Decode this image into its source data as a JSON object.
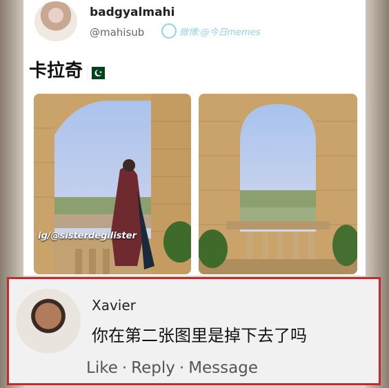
{
  "post": {
    "username": "badgyalmahi",
    "handle": "@mahisub",
    "watermark": "微博:@今日memes",
    "text": "卡拉奇",
    "flag_icon": "pakistan-flag-icon",
    "image_credit": "ig/@sisterdegilister"
  },
  "comment": {
    "name": "Xavier",
    "text": "你在第二张图里是掉下去了吗",
    "actions": [
      "Like",
      "·",
      "Reply",
      "·",
      "Message"
    ]
  },
  "colors": {
    "highlight_border": "#c8282a",
    "watermark": "#8fd3e6",
    "flag_green": "#01411c"
  }
}
